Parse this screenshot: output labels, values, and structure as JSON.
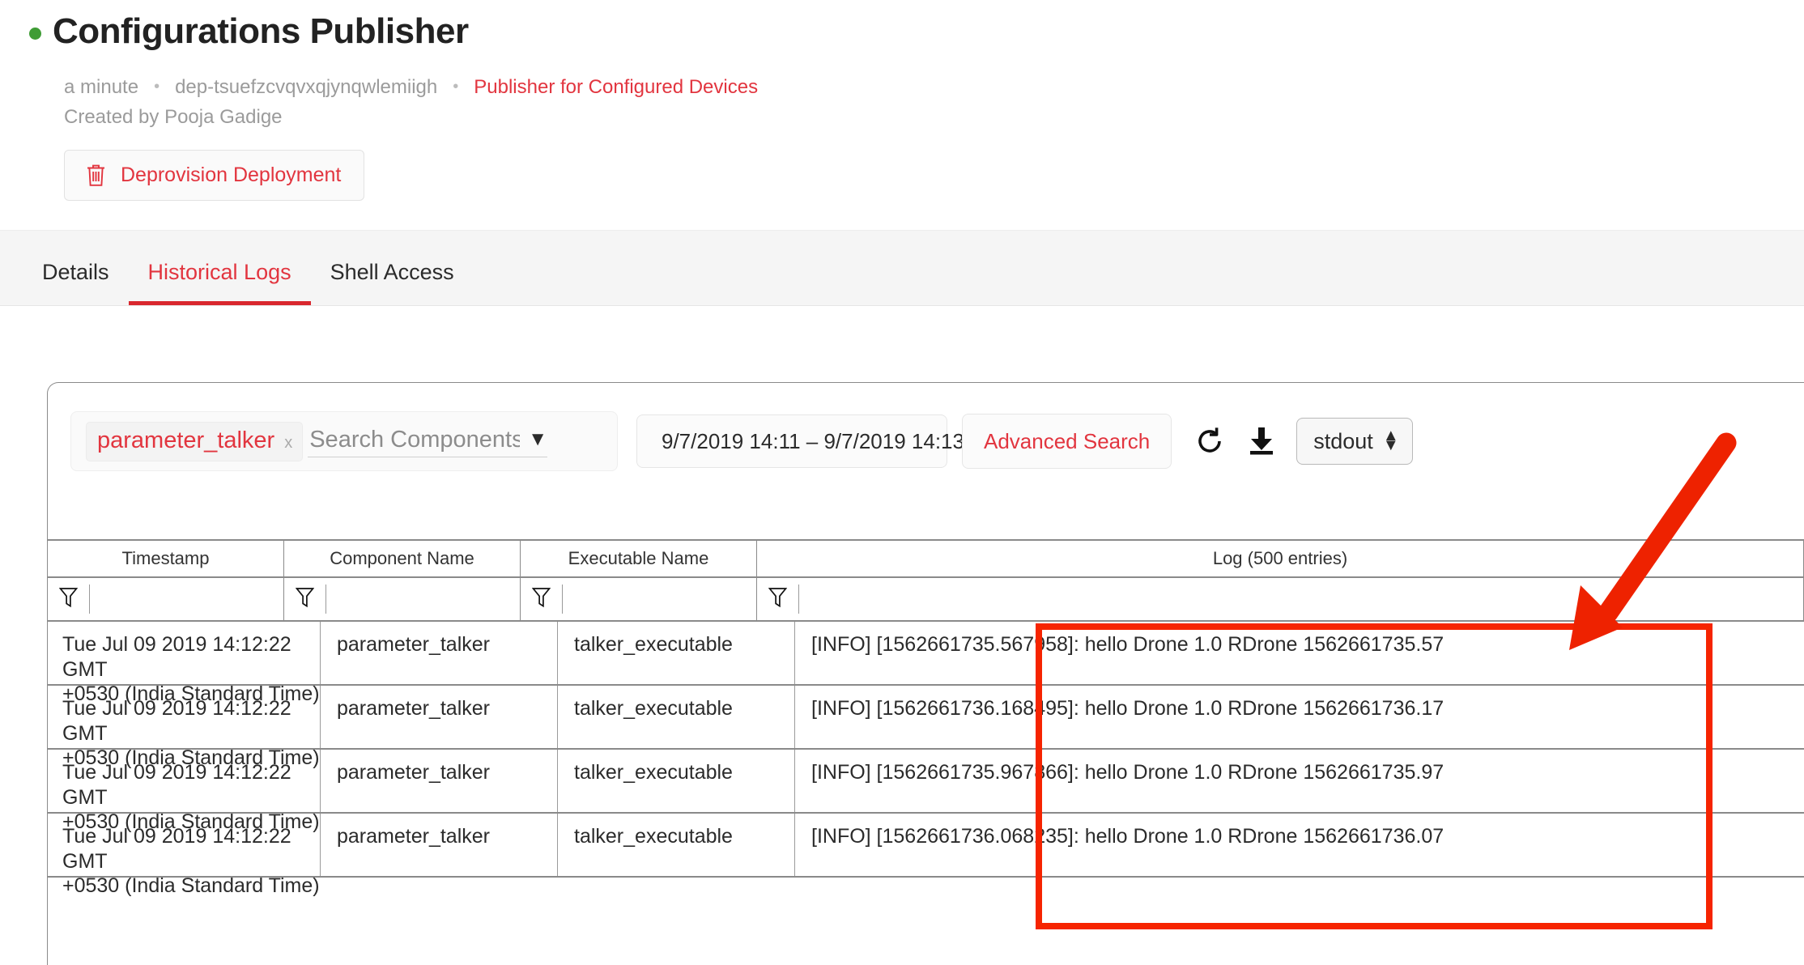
{
  "header": {
    "status_indicator": "green-dot",
    "title": "Configurations Publisher",
    "meta": {
      "age": "a minute",
      "deployment_id": "dep-tsuefzcvqvxqjynqwlemiigh",
      "package_link": "Publisher for Configured Devices",
      "separator": "•"
    },
    "created_by": "Created by Pooja Gadige",
    "deprovision_button": "Deprovision Deployment"
  },
  "tabs": [
    {
      "label": "Details",
      "active": false
    },
    {
      "label": "Historical Logs",
      "active": true
    },
    {
      "label": "Shell Access",
      "active": false
    }
  ],
  "toolbar": {
    "chip_label": "parameter_talker",
    "chip_remove": "x",
    "search_placeholder": "Search Components/E",
    "search_value": "",
    "dropdown_caret": "▼",
    "date_range": "9/7/2019 14:11 – 9/7/2019 14:13",
    "calendar_icon": "calendar-icon",
    "advanced_search": "Advanced Search",
    "refresh_icon": "refresh-icon",
    "download_icon": "download-icon",
    "stream_select_value": "stdout",
    "stream_select_up": "▲",
    "stream_select_down": "▼"
  },
  "table": {
    "columns": [
      "Timestamp",
      "Component Name",
      "Executable Name",
      "Log (500 entries)"
    ],
    "filter_icon": "filter-icon",
    "filters": [
      "",
      "",
      "",
      ""
    ],
    "rows": [
      {
        "timestamp_line1": "Tue Jul 09 2019 14:12:22 GMT",
        "timestamp_line2": "+0530 (India Standard Time)",
        "component": "parameter_talker",
        "executable": "talker_executable",
        "log": "[INFO] [1562661735.567958]: hello Drone 1.0 RDrone 1562661735.57"
      },
      {
        "timestamp_line1": "Tue Jul 09 2019 14:12:22 GMT",
        "timestamp_line2": "+0530 (India Standard Time)",
        "component": "parameter_talker",
        "executable": "talker_executable",
        "log": "[INFO] [1562661736.168495]: hello Drone 1.0 RDrone 1562661736.17"
      },
      {
        "timestamp_line1": "Tue Jul 09 2019 14:12:22 GMT",
        "timestamp_line2": "+0530 (India Standard Time)",
        "component": "parameter_talker",
        "executable": "talker_executable",
        "log": "[INFO] [1562661735.967866]: hello Drone 1.0 RDrone 1562661735.97"
      },
      {
        "timestamp_line1": "Tue Jul 09 2019 14:12:22 GMT",
        "timestamp_line2": "+0530 (India Standard Time)",
        "component": "parameter_talker",
        "executable": "talker_executable",
        "log": "[INFO] [1562661736.068235]: hello Drone 1.0 RDrone 1562661736.07"
      }
    ]
  },
  "annotations": {
    "highlight_color": "#f62400",
    "arrow_color": "#ee2200",
    "highlight_target": "log-column-cells",
    "arrow_target": "log-column-cells"
  },
  "colors": {
    "accent_red": "#e2353f",
    "status_green": "#3f9c35",
    "tab_underline": "#d9272e",
    "muted_text": "#9b9b9b"
  }
}
